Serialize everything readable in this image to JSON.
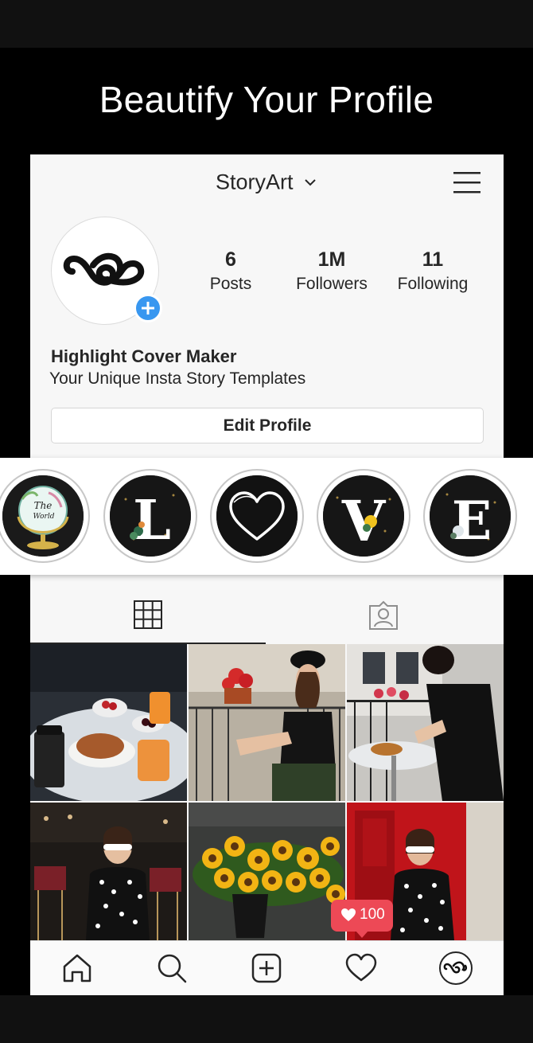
{
  "headline": "Beautify Your Profile",
  "header": {
    "username": "StoryArt",
    "menu_icon": "hamburger-menu-icon"
  },
  "profile": {
    "avatar_icon": "storyart-logo-icon",
    "stats": [
      {
        "value": "6",
        "label": "Posts"
      },
      {
        "value": "1M",
        "label": "Followers"
      },
      {
        "value": "11",
        "label": "Following"
      }
    ],
    "name": "Highlight Cover Maker",
    "bio": "Your Unique Insta Story Templates",
    "edit_button": "Edit Profile"
  },
  "highlights": [
    {
      "icon": "globe-the-world-icon"
    },
    {
      "icon": "letter-l-floral-icon",
      "letter": "L"
    },
    {
      "icon": "heart-outline-icon"
    },
    {
      "icon": "letter-v-floral-icon",
      "letter": "V"
    },
    {
      "icon": "letter-e-floral-icon",
      "letter": "E"
    }
  ],
  "tabs": [
    {
      "icon": "grid-icon",
      "active": true
    },
    {
      "icon": "tagged-person-icon",
      "active": false
    }
  ],
  "photos": [
    "breakfast-cafe-photo",
    "woman-balcony-photo",
    "woman-terrace-breakfast-photo",
    "woman-cafe-sunglasses-photo",
    "sunflowers-photo",
    "woman-red-door-photo"
  ],
  "notification": {
    "count": "100",
    "icon": "heart-icon",
    "color": "#ed4956"
  },
  "nav": [
    "home-icon",
    "search-icon",
    "new-post-icon",
    "activity-heart-icon",
    "profile-avatar-icon"
  ],
  "colors": {
    "accent": "#3897f0",
    "like": "#ed4956",
    "text": "#262626"
  }
}
